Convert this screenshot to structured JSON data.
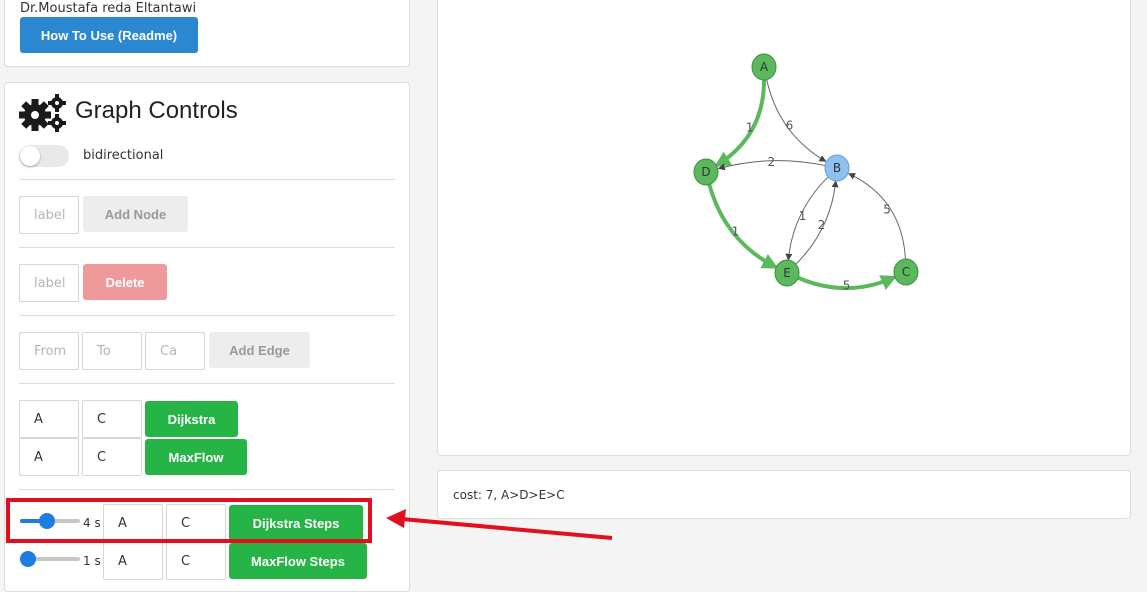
{
  "author": {
    "name": "Dr.Moustafa reda Eltantawi",
    "readme_label": "How To Use (Readme)"
  },
  "controls": {
    "title": "Graph Controls",
    "bidirectional_label": "bidirectional",
    "bidirectional_on": false,
    "add_node": {
      "placeholder": "label",
      "button": "Add Node"
    },
    "delete_node": {
      "placeholder": "label",
      "button": "Delete"
    },
    "add_edge": {
      "from_placeholder": "From",
      "to_placeholder": "To",
      "cap_placeholder": "Ca",
      "button": "Add Edge"
    },
    "dijkstra": {
      "from": "A",
      "to": "C",
      "button": "Dijkstra"
    },
    "maxflow": {
      "from": "A",
      "to": "C",
      "button": "MaxFlow"
    },
    "dijkstra_steps": {
      "speed": "4 s",
      "speed_fraction": 0.45,
      "from": "A",
      "to": "C",
      "button": "Dijkstra Steps"
    },
    "maxflow_steps": {
      "speed": "1 s",
      "speed_fraction": 0.05,
      "from": "A",
      "to": "C",
      "button": "MaxFlow Steps"
    }
  },
  "graph": {
    "colors": {
      "path_node": "#5cb85c",
      "other_node": "#8fc1f0",
      "path_edge": "#5cb85c",
      "edge": "#666666"
    },
    "nodes": [
      {
        "id": "A",
        "on_path": true
      },
      {
        "id": "B",
        "on_path": false
      },
      {
        "id": "C",
        "on_path": true
      },
      {
        "id": "D",
        "on_path": true
      },
      {
        "id": "E",
        "on_path": true
      }
    ],
    "edges": [
      {
        "from": "A",
        "to": "D",
        "weight": "1",
        "on_path": true
      },
      {
        "from": "A",
        "to": "B",
        "weight": "6",
        "on_path": false
      },
      {
        "from": "B",
        "to": "D",
        "weight": "2",
        "on_path": false
      },
      {
        "from": "D",
        "to": "E",
        "weight": "1",
        "on_path": true
      },
      {
        "from": "E",
        "to": "B",
        "weight": "2",
        "on_path": false
      },
      {
        "from": "B",
        "to": "E",
        "weight": "1",
        "on_path": false
      },
      {
        "from": "C",
        "to": "B",
        "weight": "5",
        "on_path": false
      },
      {
        "from": "E",
        "to": "C",
        "weight": "5",
        "on_path": true
      }
    ]
  },
  "result": {
    "text": "cost: 7, A>D>E>C"
  },
  "annotation": {
    "highlight_color": "#e0101f"
  }
}
